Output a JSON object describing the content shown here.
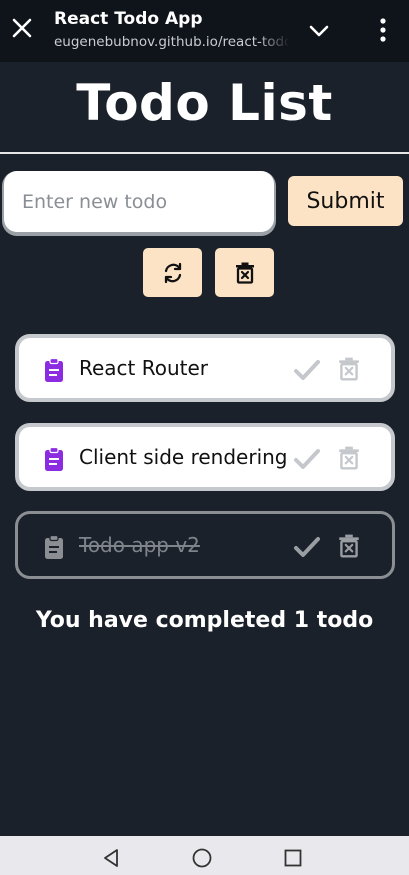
{
  "browser": {
    "page_title": "React Todo App",
    "url": "eugenebubnov.github.io/react-todo-app"
  },
  "page": {
    "title": "Todo List",
    "input_placeholder": "Enter new todo",
    "input_value": "",
    "submit_label": "Submit"
  },
  "todos": [
    {
      "text": "React Router",
      "completed": false
    },
    {
      "text": "Client side rendering",
      "completed": false
    },
    {
      "text": "Todo app v2",
      "completed": true
    }
  ],
  "summary": "You have completed 1 todo",
  "colors": {
    "background": "#1b212a",
    "button_bg": "#fde3c5",
    "clipboard_active": "#8b2be2",
    "muted": "#8b8f94"
  },
  "icons": {
    "close": "close-icon",
    "expand": "chevron-down-icon",
    "menu": "more-vert-icon",
    "refresh": "refresh-icon",
    "clear_all": "trash-x-icon",
    "todo": "clipboard-icon",
    "complete": "check-icon",
    "delete": "trash-icon",
    "nav_back": "triangle-back-icon",
    "nav_home": "circle-home-icon",
    "nav_recents": "square-recents-icon"
  }
}
